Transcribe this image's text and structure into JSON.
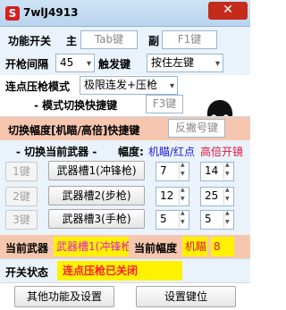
{
  "window": {
    "icon_glyph": "S",
    "title": "7wlJ4913",
    "close_glyph": "✕"
  },
  "func_switch": {
    "label": "功能开关",
    "main_label": "主",
    "main_key": "Tab键",
    "sub_label": "副",
    "sub_key": "F1键"
  },
  "fire_interval": {
    "label": "开枪间隔",
    "value": "45",
    "trigger_label": "触发键",
    "trigger_value": "按住左键"
  },
  "burst_mode": {
    "label": "连点压枪模式",
    "value": "极限连发+压枪",
    "hotkey_label": "- 模式切换快捷键",
    "hotkey_value": "F3键"
  },
  "toggle_amp": {
    "label": "切换幅度[机瞄/高倍]快捷键",
    "button": "反撇号键"
  },
  "weapon_switch": {
    "title": "- 切换当前武器 -",
    "amp_label": "幅度:",
    "amp_iron": "机瞄/红点",
    "amp_scope": "高倍开镜"
  },
  "weapons": [
    {
      "key": "1键",
      "slot": "武器槽1(冲锋枪)",
      "iron": "7",
      "scope": "14"
    },
    {
      "key": "2键",
      "slot": "武器槽2(步枪)",
      "iron": "12",
      "scope": "25"
    },
    {
      "key": "3键",
      "slot": "武器槽3(手枪)",
      "iron": "5",
      "scope": "5"
    }
  ],
  "current": {
    "weapon_label": "当前武器",
    "weapon_value": "武器槽1(冲锋枪)",
    "amp_label": "当前幅度",
    "amp_mode": "机瞄",
    "amp_value": "8"
  },
  "status": {
    "label": "开关状态",
    "value": "连点压枪已关闭"
  },
  "footer": {
    "other_button": "其他功能及设置",
    "set_hotkey_button": "设置键位"
  },
  "colors": {
    "accent_red": "#e0143c",
    "status_yellow": "#fff200",
    "orange_band": "#f6c7ae"
  }
}
